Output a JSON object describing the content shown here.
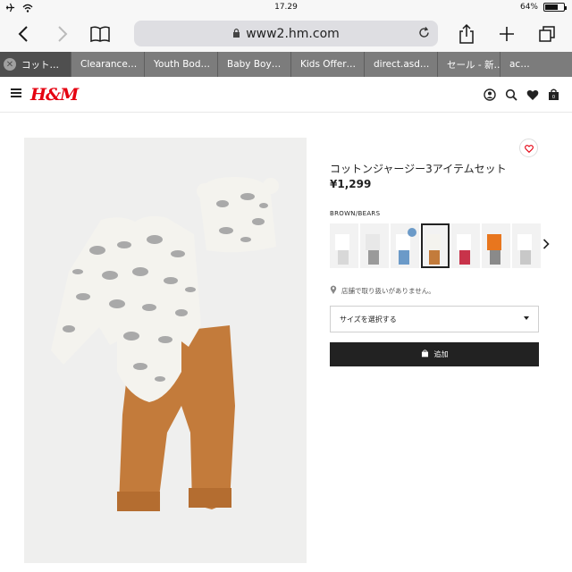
{
  "status": {
    "time": "17.29",
    "battery": "64%",
    "battery_level": 0.64
  },
  "browser": {
    "url": "www2.hm.com"
  },
  "tabs": [
    {
      "label": "コット…",
      "active": true
    },
    {
      "label": "Clearance…",
      "active": false
    },
    {
      "label": "Youth Bod…",
      "active": false
    },
    {
      "label": "Baby Boy…",
      "active": false
    },
    {
      "label": "Kids Offer…",
      "active": false
    },
    {
      "label": "direct.asd…",
      "active": false
    },
    {
      "label": "セール - 新…",
      "active": false
    },
    {
      "label": "ac…",
      "active": false
    }
  ],
  "site": {
    "logo": "H&M"
  },
  "product": {
    "title": "コットンジャージー3アイテムセット",
    "price": "¥1,299",
    "color_label": "BROWN/BEARS",
    "store_note": "店舗で取り扱いがありません。",
    "size_placeholder": "サイズを選択する",
    "add_label": "追加"
  },
  "colors": {
    "brand": "#e50010",
    "button": "#222222",
    "tabbar": "#7c7c7c",
    "tab_active": "#4f4f4f",
    "bodysuit": "#f4f3ee",
    "pants": "#c37b3b"
  }
}
